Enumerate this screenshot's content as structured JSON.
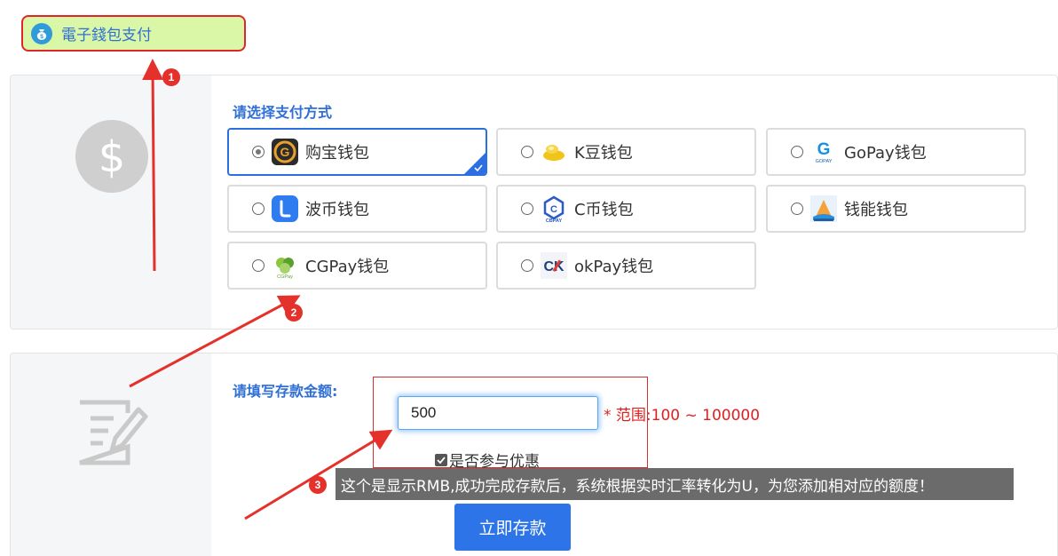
{
  "tab": {
    "label": "電子錢包支付",
    "icon": "money-bag-icon"
  },
  "payment": {
    "title": "请选择支付方式",
    "options": [
      {
        "label": "购宝钱包",
        "icon": "goubao-logo-icon",
        "selected": true
      },
      {
        "label": "K豆钱包",
        "icon": "kdou-logo-icon",
        "selected": false
      },
      {
        "label": "GoPay钱包",
        "icon": "gopay-logo-icon",
        "selected": false
      },
      {
        "label": "波币钱包",
        "icon": "bobi-logo-icon",
        "selected": false
      },
      {
        "label": "C币钱包",
        "icon": "cbpay-logo-icon",
        "selected": false
      },
      {
        "label": "钱能钱包",
        "icon": "qianneng-logo-icon",
        "selected": false
      },
      {
        "label": "CGPay钱包",
        "icon": "cgpay-logo-icon",
        "selected": false
      },
      {
        "label": "okPay钱包",
        "icon": "okpay-logo-icon",
        "selected": false
      }
    ]
  },
  "deposit": {
    "title": "请填写存款金额:",
    "amount": "500",
    "range_note": "* 范围:100 ~ 100000",
    "promo_label": "是否参与优惠",
    "promo_checked": true,
    "tooltip": "这个是显示RMB,成功完成存款后，系统根据实时汇率转化为U，为您添加相对应的额度！",
    "submit_label": "立即存款"
  },
  "annotations": [
    {
      "number": "1"
    },
    {
      "number": "2"
    },
    {
      "number": "3"
    }
  ],
  "colors": {
    "accent": "#2c6fe0",
    "annotation": "#e5312b",
    "tab_bg": "#d9f7a6",
    "range_text": "#e02020"
  }
}
